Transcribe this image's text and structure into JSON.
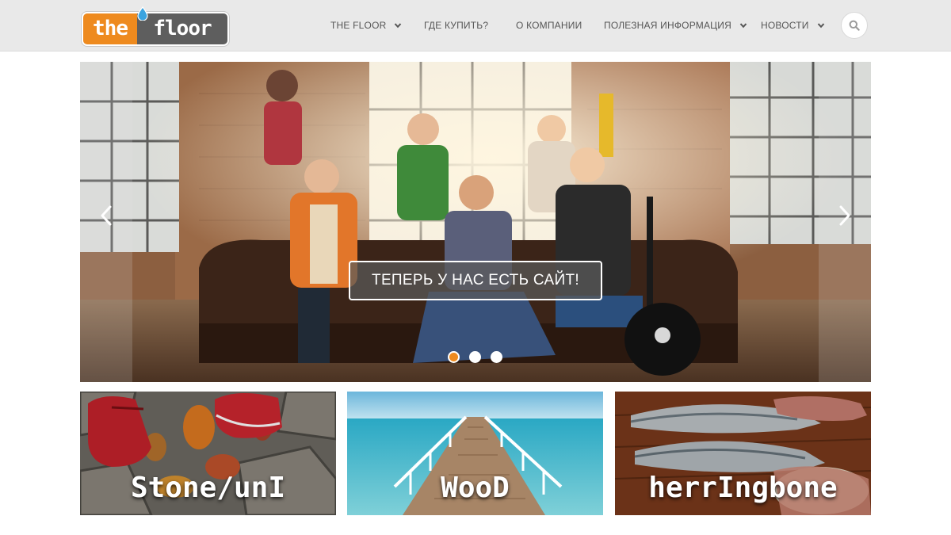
{
  "logo": {
    "left": "the",
    "right": "floor"
  },
  "nav": {
    "items": [
      {
        "label": "THE FLOOR",
        "has_dropdown": true
      },
      {
        "label": "ГДЕ КУПИТЬ?",
        "has_dropdown": false
      },
      {
        "label": "О КОМПАНИИ",
        "has_dropdown": false
      },
      {
        "label": "ПОЛЕЗНАЯ ИНФОРМАЦИЯ",
        "has_dropdown": true
      },
      {
        "label": "НОВОСТИ",
        "has_dropdown": true
      }
    ],
    "search_icon": "search-icon"
  },
  "slider": {
    "caption": "ТЕПЕРЬ У НАС ЕСТЬ САЙТ!",
    "slide_count": 3,
    "active_slide": 1,
    "prev_icon": "chevron-left-icon",
    "next_icon": "chevron-right-icon"
  },
  "tiles": [
    {
      "label": "Stone/unI"
    },
    {
      "label": "WooD"
    },
    {
      "label": "herrIngbone"
    }
  ],
  "colors": {
    "brand_orange": "#ee8a1e",
    "brand_gray": "#5e5e5e",
    "header_bg": "#e9e9e9",
    "drop_blue": "#3aa3df"
  }
}
